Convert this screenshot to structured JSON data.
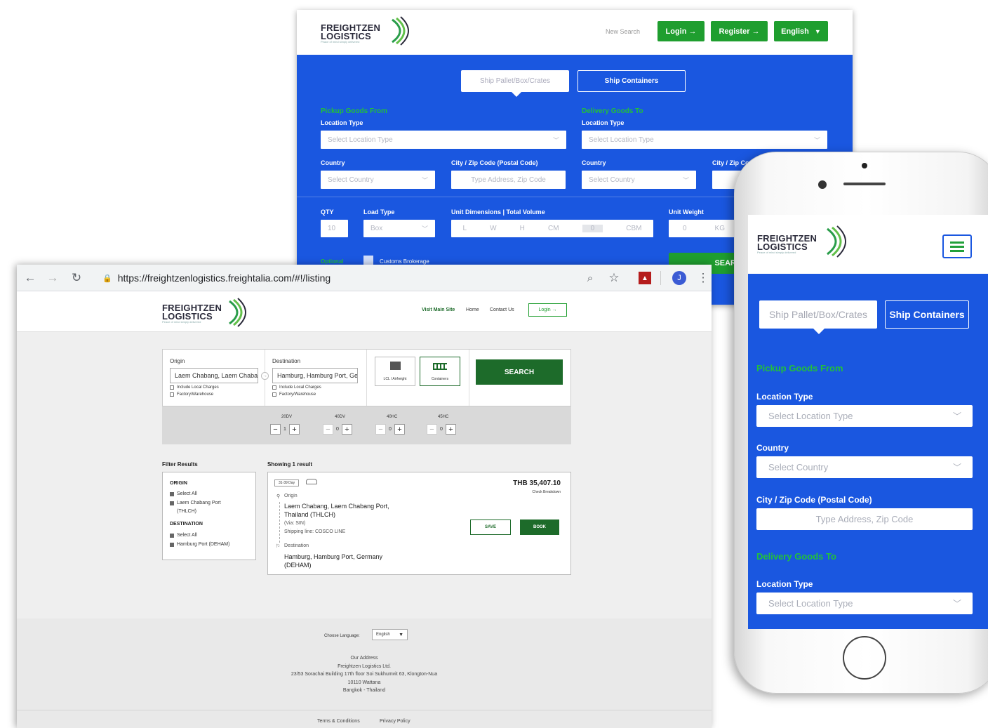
{
  "colors": {
    "primary_blue": "#1a57e0",
    "green": "#1f9e2f",
    "dark_green": "#1d6b2a",
    "label_green": "#22c03a"
  },
  "brand": {
    "line1": "FREIGHTZEN",
    "line2": "LOGISTICS",
    "tagline": "Peace of mind simply delivered"
  },
  "bg_desktop": {
    "nav": {
      "new_search": "New Search",
      "login": "Login →",
      "register": "Register →",
      "language": "English"
    },
    "tabs": {
      "pallet": "Ship Pallet/Box/Crates",
      "containers": "Ship Containers"
    },
    "pickup": {
      "heading": "Pickup Goods From",
      "location_type_label": "Location Type",
      "location_type_placeholder": "Select Location Type",
      "country_label": "Country",
      "country_placeholder": "Select Country",
      "city_label": "City / Zip Code (Postal Code)",
      "city_placeholder": "Type Address, Zip Code"
    },
    "delivery": {
      "heading": "Delivery Goods To",
      "location_type_label": "Location Type",
      "location_type_placeholder": "Select Location Type",
      "country_label": "Country",
      "country_placeholder": "Select Country",
      "city_label": "City / Zip Co"
    },
    "qty": {
      "label": "QTY",
      "value": "10"
    },
    "load_type": {
      "label": "Load Type",
      "value": "Box"
    },
    "dims": {
      "label": "Unit Dimensions | Total Volume",
      "l": "L",
      "w": "W",
      "h": "H",
      "unit": "CM",
      "volume": "0",
      "volume_unit": "CBM"
    },
    "weight": {
      "label": "Unit Weight",
      "value": "0",
      "unit": "KG"
    },
    "optional": {
      "label": "Optional",
      "customs": "Customs Brokerage"
    },
    "search": "SEAR"
  },
  "browser": {
    "url": "https://freightzenlogistics.freightalia.com/#!/listing",
    "profile": "J",
    "nav": {
      "visit_main": "Visit Main Site",
      "home": "Home",
      "contact": "Contact Us",
      "login": "Login →"
    },
    "search": {
      "origin_label": "Origin",
      "origin_value": "Laem Chabang, Laem Chabang Port",
      "destination_label": "Destination",
      "destination_value": "Hamburg, Hamburg Port, Germany",
      "include_local": "Include Local Charges",
      "factory": "Factory/Warehouse",
      "mode_lcl": "LCL / Airfreight",
      "mode_containers": "Containers",
      "search_button": "SEARCH",
      "containers": [
        {
          "label": "20DV",
          "qty": "1"
        },
        {
          "label": "40DV",
          "qty": "0"
        },
        {
          "label": "40HC",
          "qty": "0"
        },
        {
          "label": "45HC",
          "qty": "0"
        }
      ]
    },
    "filter": {
      "title": "Filter Results",
      "origin_heading": "ORIGIN",
      "select_all": "Select All",
      "origin_port_line1": "Laem Chabang Port",
      "origin_port_line2": "(THLCH)",
      "destination_heading": "DESTINATION",
      "select_all_2": "Select All",
      "dest_port": "Hamburg Port (DEHAM)"
    },
    "results": {
      "showing": "Showing 1 result",
      "transit": "31-39 Day",
      "price": "THB 35,407.10",
      "check": "Check Breakdown",
      "origin_label": "Origin",
      "origin_line1": "Laem Chabang, Laem Chabang Port,",
      "origin_line2": "Thailand (THLCH)",
      "via": "(Via: SIN)",
      "shipping_line": "Shipping line: COSCO LINE",
      "destination_label": "Destination",
      "dest_line1": "Hamburg, Hamburg Port, Germany",
      "dest_line2": "(DEHAM)",
      "save": "SAVE",
      "book": "BOOK"
    },
    "footer": {
      "choose_language": "Choose Language:",
      "language": "English",
      "addr_title": "Our Address",
      "addr_company": "Freightzen Logistics Ltd.",
      "addr_line1": "23/53 Sorachai Building 17th floor Soi Sukhumvit 63, Klongton-Nua",
      "addr_line2": "10110 Wattana",
      "addr_line3": "Bangkok - Thailand",
      "terms": "Terms & Conditions",
      "privacy": "Privacy Policy"
    }
  },
  "phone": {
    "tabs": {
      "pallet": "Ship Pallet/Box/Crates",
      "containers": "Ship Containers"
    },
    "pickup_heading": "Pickup Goods From",
    "location_type_label": "Location Type",
    "location_type_placeholder": "Select Location Type",
    "country_label": "Country",
    "country_placeholder": "Select Country",
    "city_label": "City / Zip Code (Postal Code)",
    "city_placeholder": "Type Address, Zip Code",
    "delivery_heading": "Delivery Goods To",
    "delivery_location_label": "Location Type",
    "delivery_location_placeholder": "Select Location Type"
  }
}
